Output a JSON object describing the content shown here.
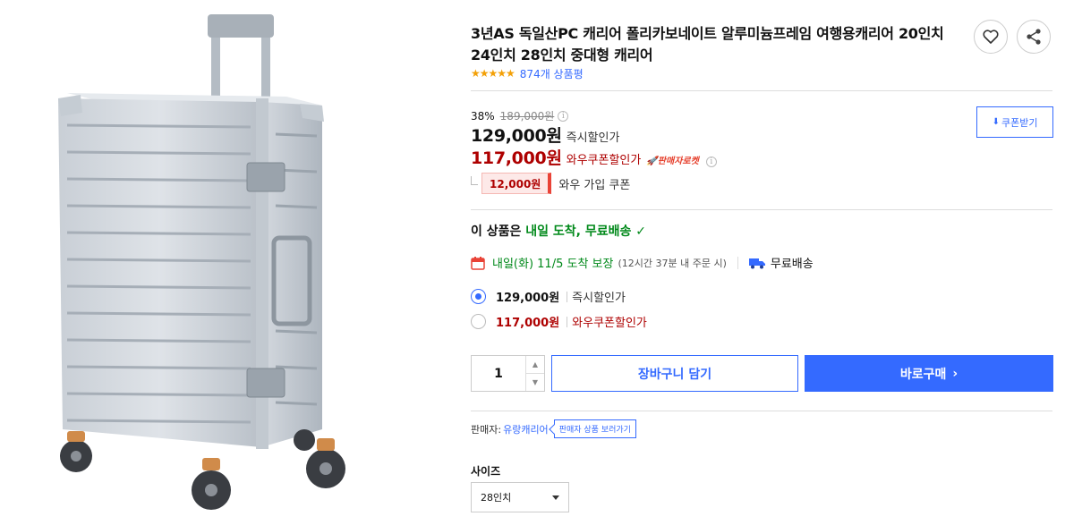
{
  "product": {
    "title": "3년AS 독일산PC 캐리어 폴리카보네이트 알루미늄프레임 여행용캐리어 20인치 24인치 28인치 중대형 캐리어",
    "rating_stars": "★★★★★",
    "review_count": "874개 상품평",
    "icons": {
      "wishlist": "heart-icon",
      "share": "share-icon"
    }
  },
  "pricing": {
    "discount_rate": "38%",
    "original_price": "189,000원",
    "instant_price": "129,000원",
    "instant_label": "즉시할인가",
    "wow_price": "117,000원",
    "wow_label": "와우쿠폰할인가",
    "rocket_badge": "🚀판매자로켓",
    "coupon_amount": "12,000원",
    "coupon_desc": "와우 가입 쿠폰",
    "coupon_button": "쿠폰받기"
  },
  "delivery": {
    "prefix": "이 상품은 ",
    "highlight": "내일 도착, 무료배송",
    "check": "✓",
    "arrival": "내일(화) 11/5 도착 보장",
    "cutoff": "(12시간 37분 내 주문 시)",
    "shipping": "무료배송"
  },
  "options": [
    {
      "price": "129,000원",
      "label": "즉시할인가",
      "selected": true
    },
    {
      "price": "117,000원",
      "label": "와우쿠폰할인가",
      "selected": false
    }
  ],
  "purchase": {
    "quantity": "1",
    "stepper_up": "▲",
    "stepper_down": "▼",
    "cart_label": "장바구니 담기",
    "buy_label": "바로구매",
    "buy_chevron": "›"
  },
  "seller": {
    "label": "판매자:",
    "name": "유랑캐리어",
    "link": "판매자 상품 보러가기"
  },
  "size": {
    "label": "사이즈",
    "selected": "28인치"
  },
  "colors": {
    "accent": "#346aff",
    "sale_red": "#ae0000",
    "delivery_green": "#00891a",
    "star": "#f3a007"
  }
}
